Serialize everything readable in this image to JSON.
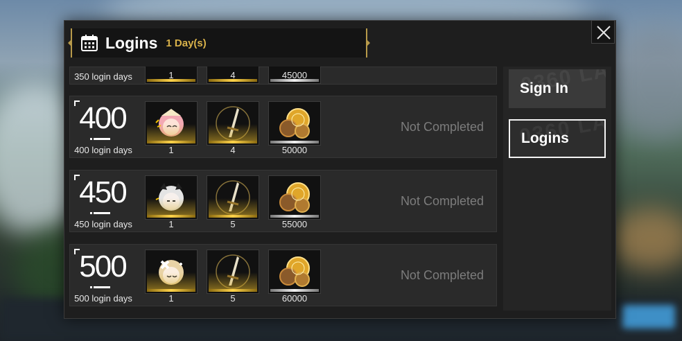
{
  "header": {
    "title": "Logins",
    "days": "1 Day(s)",
    "icon": "calendar-icon"
  },
  "close": {
    "icon": "close-icon"
  },
  "tabs": [
    {
      "label": "Sign In",
      "selected": false
    },
    {
      "label": "Logins",
      "selected": true
    }
  ],
  "rows": [
    {
      "milestone": "350",
      "label": "350 login days",
      "rewards": [
        {
          "item": "character-avatar",
          "qty": "1"
        },
        {
          "item": "lance-weapon",
          "qty": "4"
        },
        {
          "item": "gold-coins",
          "qty": "45000"
        }
      ],
      "status": ""
    },
    {
      "milestone": "400",
      "label": "400 login days",
      "rewards": [
        {
          "item": "character-avatar",
          "qty": "1"
        },
        {
          "item": "lance-weapon",
          "qty": "4"
        },
        {
          "item": "gold-coins",
          "qty": "50000"
        }
      ],
      "status": "Not Completed"
    },
    {
      "milestone": "450",
      "label": "450 login days",
      "rewards": [
        {
          "item": "character-avatar",
          "qty": "1"
        },
        {
          "item": "lance-weapon",
          "qty": "5"
        },
        {
          "item": "gold-coins",
          "qty": "55000"
        }
      ],
      "status": "Not Completed"
    },
    {
      "milestone": "500",
      "label": "500 login days",
      "rewards": [
        {
          "item": "character-avatar",
          "qty": "1"
        },
        {
          "item": "lance-weapon",
          "qty": "5"
        },
        {
          "item": "gold-coins",
          "qty": "60000"
        }
      ],
      "status": "Not Completed"
    }
  ],
  "colors": {
    "accent_gold": "#d9b24a",
    "status_gray": "#7c7c7c",
    "panel_bg": "#1e1e1e"
  }
}
